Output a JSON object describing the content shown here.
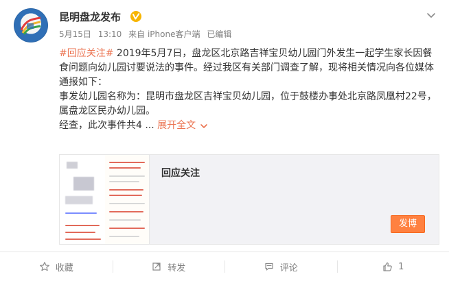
{
  "post": {
    "author": "昆明盘龙发布",
    "meta": {
      "date": "5月15日",
      "time": "13:10",
      "source": "来自 iPhone客户端",
      "edited": "已编辑"
    },
    "text": {
      "hashtag": "#回应关注#",
      "p1": " 2019年5月7日，盘龙区北京路吉祥宝贝幼儿园门外发生一起学生家长因餐食问题向幼儿园讨要说法的事件。经过我区有关部门调查了解，现将相关情况向各位媒体通报如下：",
      "p2": "事发幼儿园名称为：昆明市盘龙区吉祥宝贝幼儿园，位于鼓楼办事处北京路凤凰村22号，属盘龙区民办幼儿园。",
      "p3_start": "经查，此次事件共4 ... ",
      "expand": "展开全文"
    },
    "linkcard": {
      "title": "回应关注",
      "button": "发博"
    },
    "actions": {
      "favorite": "收藏",
      "repost": "转发",
      "comment": "评论",
      "like": "1"
    }
  },
  "colors": {
    "accent": "#eb7350",
    "button": "#ff8140",
    "muted": "#808080",
    "text": "#333333",
    "card_bg": "#f2f2f5"
  },
  "icons": {
    "verified": "verified-badge-icon",
    "chevron": "chevron-down-icon",
    "favorite": "star-icon",
    "repost": "share-icon",
    "comment": "comment-icon",
    "like": "thumbs-up-icon"
  }
}
